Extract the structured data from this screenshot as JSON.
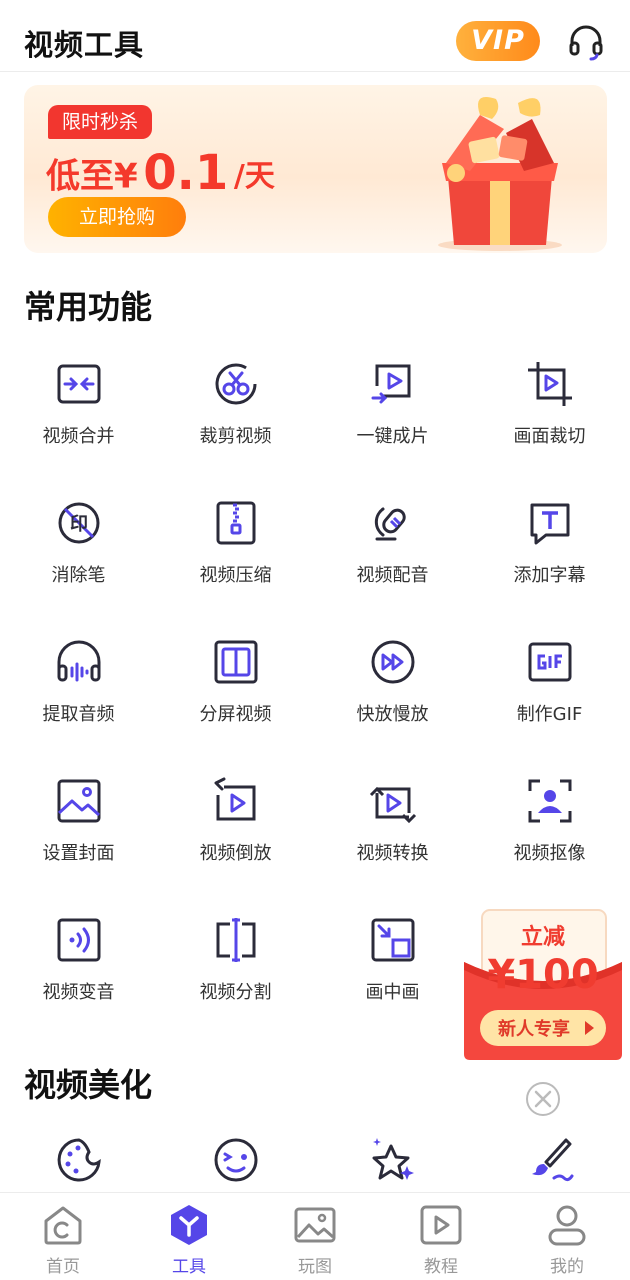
{
  "header": {
    "title": "视频工具",
    "vip_label": "VIP"
  },
  "banner": {
    "tag": "限时秒杀",
    "price_prefix": "低至¥",
    "price_value": "0.1",
    "price_unit": "/天",
    "buy_label": "立即抢购"
  },
  "sections": {
    "common_title": "常用功能",
    "beautify_title": "视频美化"
  },
  "common_tools": [
    {
      "label": "视频合并",
      "icon": "merge-icon"
    },
    {
      "label": "裁剪视频",
      "icon": "scissors-icon"
    },
    {
      "label": "一键成片",
      "icon": "one-click-icon"
    },
    {
      "label": "画面裁切",
      "icon": "crop-icon"
    },
    {
      "label": "消除笔",
      "icon": "eraser-icon"
    },
    {
      "label": "视频压缩",
      "icon": "compress-icon"
    },
    {
      "label": "视频配音",
      "icon": "dubbing-icon"
    },
    {
      "label": "添加字幕",
      "icon": "subtitle-icon"
    },
    {
      "label": "提取音频",
      "icon": "headphones-icon"
    },
    {
      "label": "分屏视频",
      "icon": "split-screen-icon"
    },
    {
      "label": "快放慢放",
      "icon": "fast-forward-icon"
    },
    {
      "label": "制作GIF",
      "icon": "gif-icon"
    },
    {
      "label": "设置封面",
      "icon": "image-icon"
    },
    {
      "label": "视频倒放",
      "icon": "reverse-icon"
    },
    {
      "label": "视频转换",
      "icon": "convert-icon"
    },
    {
      "label": "视频抠像",
      "icon": "portrait-icon"
    },
    {
      "label": "视频变音",
      "icon": "voice-change-icon"
    },
    {
      "label": "视频分割",
      "icon": "split-icon"
    },
    {
      "label": "画中画",
      "icon": "picture-in-picture-icon"
    }
  ],
  "beautify_tools": [
    {
      "icon": "palette-icon"
    },
    {
      "icon": "smiley-icon"
    },
    {
      "icon": "star-sparkle-icon"
    },
    {
      "icon": "brush-icon"
    }
  ],
  "coupon": {
    "title": "立减",
    "amount": "¥100",
    "cta": "新人专享"
  },
  "tabbar": [
    {
      "label": "首页",
      "icon": "home-icon",
      "active": false
    },
    {
      "label": "工具",
      "icon": "tools-icon",
      "active": true
    },
    {
      "label": "玩图",
      "icon": "gallery-icon",
      "active": false
    },
    {
      "label": "教程",
      "icon": "tutorial-icon",
      "active": false
    },
    {
      "label": "我的",
      "icon": "profile-icon",
      "active": false
    }
  ],
  "colors": {
    "accent": "#5546e8",
    "icon_dark": "#2b2b3a",
    "promo_red": "#f4392b",
    "promo_orange": "#ff8a1a"
  }
}
